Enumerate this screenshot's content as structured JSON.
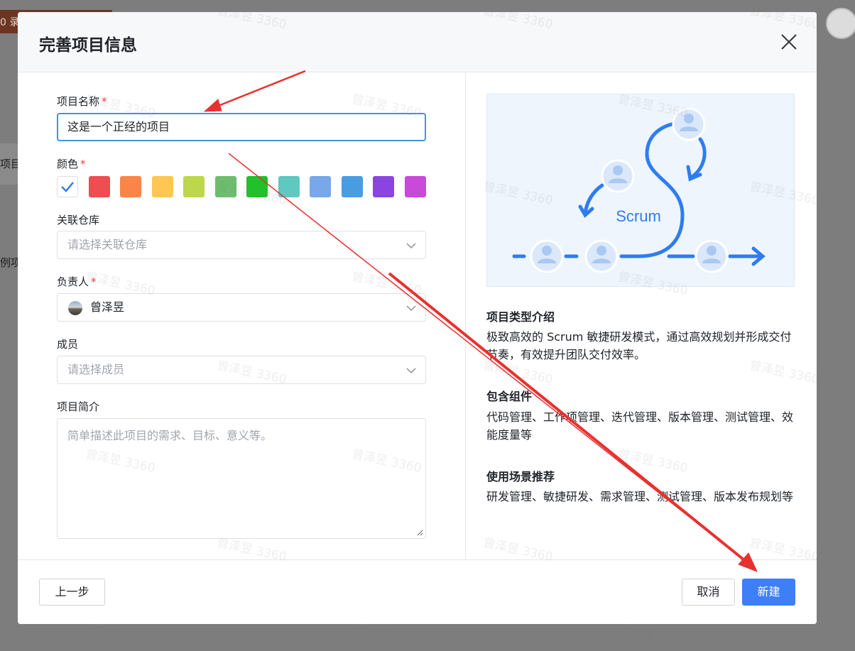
{
  "background": {
    "tab_text": "0 录",
    "row_text": "项目",
    "row_text_2": "例项"
  },
  "dialog": {
    "title": "完善项目信息",
    "close_icon": "close-icon"
  },
  "form": {
    "name_label": "项目名称",
    "name_value": "这是一个正经的项目",
    "required_mark": "*",
    "color_label": "颜色",
    "colors": [
      "#ffffff",
      "#ee4d51",
      "#fb8447",
      "#fdc751",
      "#bcd74c",
      "#6ebd6e",
      "#21c12a",
      "#5ec8c1",
      "#78a7ea",
      "#4a9ce1",
      "#8a45e0",
      "#c84ad9"
    ],
    "selected_color_index": 0,
    "repo_label": "关联仓库",
    "repo_placeholder": "请选择关联仓库",
    "owner_label": "负责人",
    "owner_value": "曾泽昱",
    "member_label": "成员",
    "member_placeholder": "请选择成员",
    "desc_label": "项目简介",
    "desc_placeholder": "简单描述此项目的需求、目标、意义等。"
  },
  "info": {
    "illustration_label": "Scrum",
    "type_title": "项目类型介绍",
    "type_body": "极致高效的 Scrum 敏捷研发模式，通过高效规划并形成交付节奏，有效提升团队交付效率。",
    "components_title": "包含组件",
    "components_body": "代码管理、工作项管理、迭代管理、版本管理、测试管理、效能度量等",
    "scenes_title": "使用场景推荐",
    "scenes_body": "研发管理、敏捷研发、需求管理、测试管理、版本发布规划等"
  },
  "footer": {
    "prev_label": "上一步",
    "cancel_label": "取消",
    "create_label": "新建"
  },
  "watermark": "曾泽昱 3360",
  "colors": {
    "primary": "#3d7ff6",
    "focus_border": "#4a90e2",
    "required": "#f04142",
    "annotation_arrow": "#e8312f"
  }
}
